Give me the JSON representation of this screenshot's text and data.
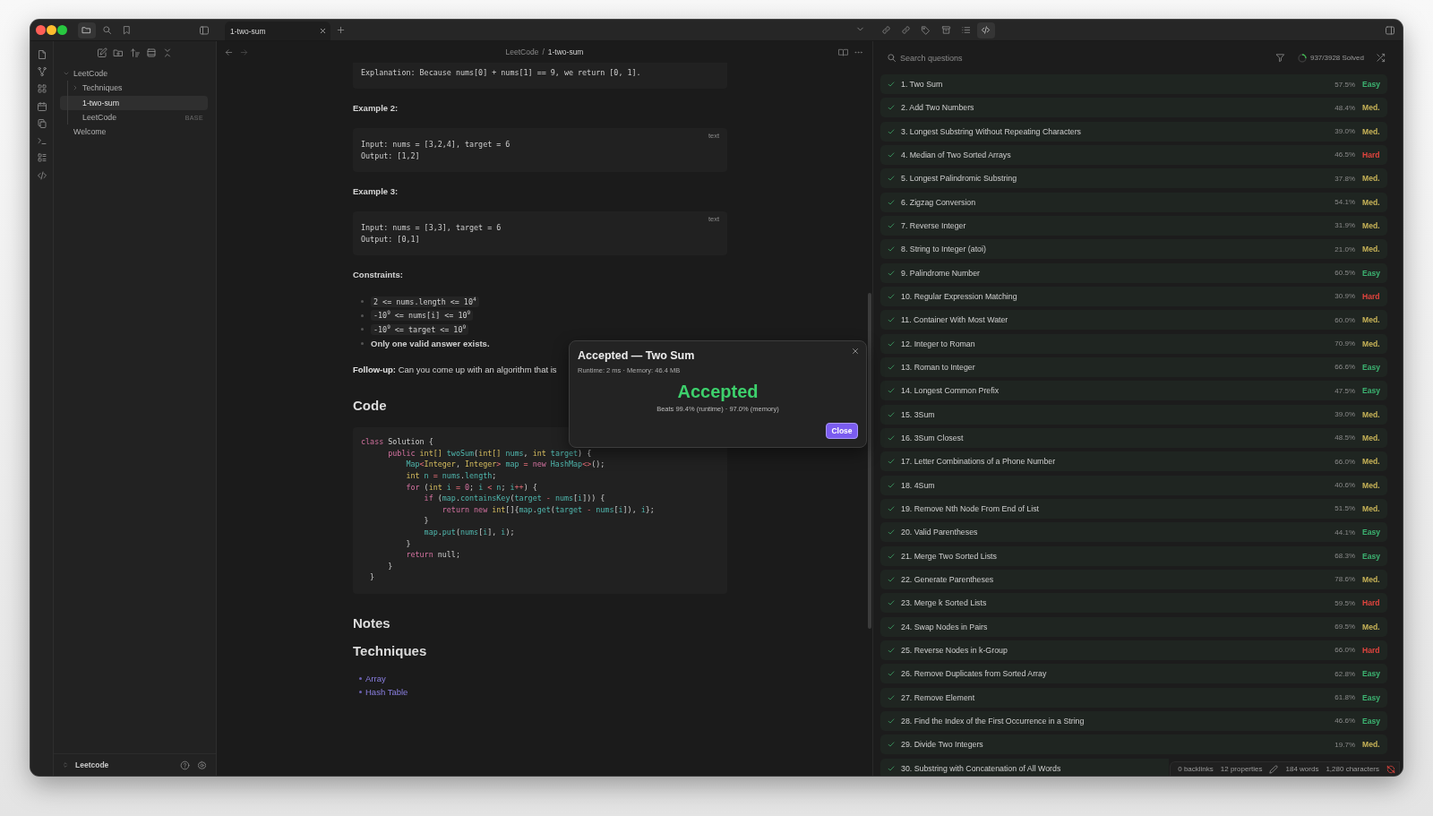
{
  "titlebar": {
    "left_tabs": [
      {
        "selected": true
      },
      {
        "selected": false
      },
      {
        "selected": false
      }
    ],
    "tabs": [
      {
        "label": "1-two-sum",
        "selected": true
      }
    ],
    "right_tabs": [
      {
        "selected": false
      },
      {
        "selected": false
      },
      {
        "selected": false
      },
      {
        "selected": false
      },
      {
        "selected": false
      },
      {
        "selected": true
      }
    ]
  },
  "sidebar": {
    "tree": [
      {
        "label": "LeetCode",
        "kind": "folder",
        "expanded": true,
        "children": [
          {
            "label": "Techniques",
            "kind": "folder",
            "expanded": false
          },
          {
            "label": "1-two-sum",
            "kind": "file",
            "selected": true
          },
          {
            "label": "LeetCode",
            "kind": "file",
            "selected": false,
            "badge": "BASE"
          }
        ]
      },
      {
        "label": "Welcome",
        "kind": "file",
        "selected": false
      }
    ],
    "vault": "Leetcode"
  },
  "editor": {
    "breadcrumb": {
      "parts": [
        "LeetCode",
        "1-two-sum"
      ],
      "separator": "/"
    },
    "blocks": [
      {
        "kind": "example",
        "lines": [
          "Explanation: Because nums[0] + nums[1] == 9, we return [0, 1]."
        ]
      },
      {
        "kind": "label",
        "text": "Example 2:"
      },
      {
        "kind": "example",
        "lang": "text",
        "lines": [
          "Input: nums = [3,2,4], target = 6",
          "Output: [1,2]"
        ]
      },
      {
        "kind": "label",
        "text": "Example 3:"
      },
      {
        "kind": "example",
        "lang": "text",
        "lines": [
          "Input: nums = [3,3], target = 6",
          "Output: [0,1]"
        ]
      },
      {
        "kind": "label",
        "text": "Constraints:"
      },
      {
        "kind": "bullets",
        "items": [
          {
            "text": "2 <= nums.length <= 10$^{4}$",
            "code": true,
            "bold": false
          },
          {
            "text": "-10$^{9}$ <= nums[i] <= 10$^{9}$",
            "code": true,
            "bold": false
          },
          {
            "text": "-10$^{9}$ <= target <= 10$^{9}$",
            "code": true,
            "bold": false
          },
          {
            "text": "Only one valid answer exists.",
            "code": false,
            "bold": true
          }
        ]
      },
      {
        "kind": "paragraph",
        "text": "**Follow-up:** Can you come up with an algorithm that is"
      },
      {
        "kind": "heading",
        "text": "Code"
      },
      {
        "kind": "code",
        "lines": [
          [
            {
              "kind": "kw",
              "text": "class"
            },
            {
              "kind": "p",
              "text": " Solution {"
            }
          ],
          [
            {
              "kind": "kw",
              "text": "      public"
            },
            {
              "kind": "ty",
              "text": " int[]"
            },
            {
              "kind": "fn",
              "text": " twoSum"
            },
            {
              "kind": "p",
              "text": "("
            },
            {
              "kind": "ty",
              "text": "int[]"
            },
            {
              "kind": "fn",
              "text": " nums"
            },
            {
              "kind": "p",
              "text": ", "
            },
            {
              "kind": "ty",
              "text": "int"
            },
            {
              "kind": "fn",
              "text": " target"
            },
            {
              "kind": "p",
              "text": ") {"
            }
          ],
          [
            {
              "kind": "fn",
              "text": "          Map"
            },
            {
              "kind": "op",
              "text": "<"
            },
            {
              "kind": "ty",
              "text": "Integer"
            },
            {
              "kind": "p",
              "text": ", "
            },
            {
              "kind": "ty",
              "text": "Integer"
            },
            {
              "kind": "op",
              "text": ">"
            },
            {
              "kind": "fn",
              "text": " map"
            },
            {
              "kind": "op",
              "text": " ="
            },
            {
              "kind": "kw",
              "text": " new"
            },
            {
              "kind": "fn",
              "text": " HashMap"
            },
            {
              "kind": "op",
              "text": "<>"
            },
            {
              "kind": "p",
              "text": "();"
            }
          ],
          [
            {
              "kind": "ty",
              "text": "          int"
            },
            {
              "kind": "fn",
              "text": " n"
            },
            {
              "kind": "op",
              "text": " ="
            },
            {
              "kind": "fn",
              "text": " nums"
            },
            {
              "kind": "p",
              "text": "."
            },
            {
              "kind": "fn",
              "text": "length"
            },
            {
              "kind": "p",
              "text": ";"
            }
          ],
          [
            {
              "kind": "kw",
              "text": "          for"
            },
            {
              "kind": "p",
              "text": " ("
            },
            {
              "kind": "ty",
              "text": "int"
            },
            {
              "kind": "fn",
              "text": " i"
            },
            {
              "kind": "op",
              "text": " ="
            },
            {
              "kind": "num",
              "text": " 0"
            },
            {
              "kind": "p",
              "text": "; "
            },
            {
              "kind": "fn",
              "text": "i"
            },
            {
              "kind": "op",
              "text": " <"
            },
            {
              "kind": "fn",
              "text": " n"
            },
            {
              "kind": "p",
              "text": "; "
            },
            {
              "kind": "fn",
              "text": "i"
            },
            {
              "kind": "op",
              "text": "++"
            },
            {
              "kind": "p",
              "text": ") {"
            }
          ],
          [
            {
              "kind": "kw",
              "text": "              if"
            },
            {
              "kind": "p",
              "text": " ("
            },
            {
              "kind": "fn",
              "text": "map"
            },
            {
              "kind": "p",
              "text": "."
            },
            {
              "kind": "fn",
              "text": "containsKey"
            },
            {
              "kind": "p",
              "text": "("
            },
            {
              "kind": "fn",
              "text": "target"
            },
            {
              "kind": "op",
              "text": " -"
            },
            {
              "kind": "fn",
              "text": " nums"
            },
            {
              "kind": "p",
              "text": "["
            },
            {
              "kind": "fn",
              "text": "i"
            },
            {
              "kind": "p",
              "text": "])) {"
            }
          ],
          [
            {
              "kind": "kw",
              "text": "                  return"
            },
            {
              "kind": "kw",
              "text": " new"
            },
            {
              "kind": "ty",
              "text": " int"
            },
            {
              "kind": "p",
              "text": "[]{"
            },
            {
              "kind": "fn",
              "text": "map"
            },
            {
              "kind": "p",
              "text": "."
            },
            {
              "kind": "fn",
              "text": "get"
            },
            {
              "kind": "p",
              "text": "("
            },
            {
              "kind": "fn",
              "text": "target"
            },
            {
              "kind": "op",
              "text": " -"
            },
            {
              "kind": "fn",
              "text": " nums"
            },
            {
              "kind": "p",
              "text": "["
            },
            {
              "kind": "fn",
              "text": "i"
            },
            {
              "kind": "p",
              "text": "]), "
            },
            {
              "kind": "fn",
              "text": "i"
            },
            {
              "kind": "p",
              "text": "};"
            }
          ],
          [
            {
              "kind": "p",
              "text": "              }"
            }
          ],
          [
            {
              "kind": "fn",
              "text": "              map"
            },
            {
              "kind": "p",
              "text": "."
            },
            {
              "kind": "fn",
              "text": "put"
            },
            {
              "kind": "p",
              "text": "("
            },
            {
              "kind": "fn",
              "text": "nums"
            },
            {
              "kind": "p",
              "text": "["
            },
            {
              "kind": "fn",
              "text": "i"
            },
            {
              "kind": "p",
              "text": "], "
            },
            {
              "kind": "fn",
              "text": "i"
            },
            {
              "kind": "p",
              "text": ");"
            }
          ],
          [
            {
              "kind": "p",
              "text": "          }"
            }
          ],
          [
            {
              "kind": "kw",
              "text": "          return"
            },
            {
              "kind": "p",
              "text": " null;"
            }
          ],
          [
            {
              "kind": "p",
              "text": "      }"
            }
          ],
          [
            {
              "kind": "p",
              "text": "  }"
            }
          ]
        ]
      },
      {
        "kind": "heading",
        "text": "Notes"
      },
      {
        "kind": "heading",
        "text": "Techniques"
      },
      {
        "kind": "links",
        "items": [
          "Array",
          "Hash Table"
        ]
      }
    ]
  },
  "questions": {
    "search": {
      "placeholder": "Search questions"
    },
    "progress": {
      "label": "937/3928 Solved",
      "level": 0.24
    },
    "problems": [
      {
        "title": "1. Two Sum",
        "solved": true,
        "rate": "57.5%",
        "difficulty": "Easy",
        "color": "#3cb371"
      },
      {
        "title": "2. Add Two Numbers",
        "solved": true,
        "rate": "48.4%",
        "difficulty": "Med.",
        "color": "#c9b458"
      },
      {
        "title": "3. Longest Substring Without Repeating Characters",
        "solved": true,
        "rate": "39.0%",
        "difficulty": "Med.",
        "color": "#c9b458"
      },
      {
        "title": "4. Median of Two Sorted Arrays",
        "solved": true,
        "rate": "46.5%",
        "difficulty": "Hard",
        "color": "#e0443e"
      },
      {
        "title": "5. Longest Palindromic Substring",
        "solved": true,
        "rate": "37.8%",
        "difficulty": "Med.",
        "color": "#c9b458"
      },
      {
        "title": "6. Zigzag Conversion",
        "solved": true,
        "rate": "54.1%",
        "difficulty": "Med.",
        "color": "#c9b458"
      },
      {
        "title": "7. Reverse Integer",
        "solved": true,
        "rate": "31.9%",
        "difficulty": "Med.",
        "color": "#c9b458"
      },
      {
        "title": "8. String to Integer (atoi)",
        "solved": true,
        "rate": "21.0%",
        "difficulty": "Med.",
        "color": "#c9b458"
      },
      {
        "title": "9. Palindrome Number",
        "solved": true,
        "rate": "60.5%",
        "difficulty": "Easy",
        "color": "#3cb371"
      },
      {
        "title": "10. Regular Expression Matching",
        "solved": true,
        "rate": "30.9%",
        "difficulty": "Hard",
        "color": "#e0443e"
      },
      {
        "title": "11. Container With Most Water",
        "solved": true,
        "rate": "60.0%",
        "difficulty": "Med.",
        "color": "#c9b458"
      },
      {
        "title": "12. Integer to Roman",
        "solved": true,
        "rate": "70.9%",
        "difficulty": "Med.",
        "color": "#c9b458"
      },
      {
        "title": "13. Roman to Integer",
        "solved": true,
        "rate": "66.6%",
        "difficulty": "Easy",
        "color": "#3cb371"
      },
      {
        "title": "14. Longest Common Prefix",
        "solved": true,
        "rate": "47.5%",
        "difficulty": "Easy",
        "color": "#3cb371"
      },
      {
        "title": "15. 3Sum",
        "solved": true,
        "rate": "39.0%",
        "difficulty": "Med.",
        "color": "#c9b458"
      },
      {
        "title": "16. 3Sum Closest",
        "solved": true,
        "rate": "48.5%",
        "difficulty": "Med.",
        "color": "#c9b458"
      },
      {
        "title": "17. Letter Combinations of a Phone Number",
        "solved": true,
        "rate": "66.0%",
        "difficulty": "Med.",
        "color": "#c9b458"
      },
      {
        "title": "18. 4Sum",
        "solved": true,
        "rate": "40.6%",
        "difficulty": "Med.",
        "color": "#c9b458"
      },
      {
        "title": "19. Remove Nth Node From End of List",
        "solved": true,
        "rate": "51.5%",
        "difficulty": "Med.",
        "color": "#c9b458"
      },
      {
        "title": "20. Valid Parentheses",
        "solved": true,
        "rate": "44.1%",
        "difficulty": "Easy",
        "color": "#3cb371"
      },
      {
        "title": "21. Merge Two Sorted Lists",
        "solved": true,
        "rate": "68.3%",
        "difficulty": "Easy",
        "color": "#3cb371"
      },
      {
        "title": "22. Generate Parentheses",
        "solved": true,
        "rate": "78.6%",
        "difficulty": "Med.",
        "color": "#c9b458"
      },
      {
        "title": "23. Merge k Sorted Lists",
        "solved": true,
        "rate": "59.5%",
        "difficulty": "Hard",
        "color": "#e0443e"
      },
      {
        "title": "24. Swap Nodes in Pairs",
        "solved": true,
        "rate": "69.5%",
        "difficulty": "Med.",
        "color": "#c9b458"
      },
      {
        "title": "25. Reverse Nodes in k-Group",
        "solved": true,
        "rate": "66.0%",
        "difficulty": "Hard",
        "color": "#e0443e"
      },
      {
        "title": "26. Remove Duplicates from Sorted Array",
        "solved": true,
        "rate": "62.8%",
        "difficulty": "Easy",
        "color": "#3cb371"
      },
      {
        "title": "27. Remove Element",
        "solved": true,
        "rate": "61.8%",
        "difficulty": "Easy",
        "color": "#3cb371"
      },
      {
        "title": "28. Find the Index of the First Occurrence in a String",
        "solved": true,
        "rate": "46.6%",
        "difficulty": "Easy",
        "color": "#3cb371"
      },
      {
        "title": "29. Divide Two Integers",
        "solved": true,
        "rate": "19.7%",
        "difficulty": "Med.",
        "color": "#c9b458"
      },
      {
        "title": "30. Substring with Concatenation of All Words",
        "solved": true
      }
    ]
  },
  "status_bar": {
    "backlinks": "0 backlinks",
    "properties": "12 properties",
    "words": "184 words",
    "characters": "1,280 characters"
  },
  "dialog": {
    "title": "Accepted — Two Sum",
    "meta": "Runtime: 2 ms · Memory: 46.4 MB",
    "verdict": "Accepted",
    "beats": "Beats 99.4% (runtime) · 97.0% (memory)",
    "button": "Close"
  }
}
